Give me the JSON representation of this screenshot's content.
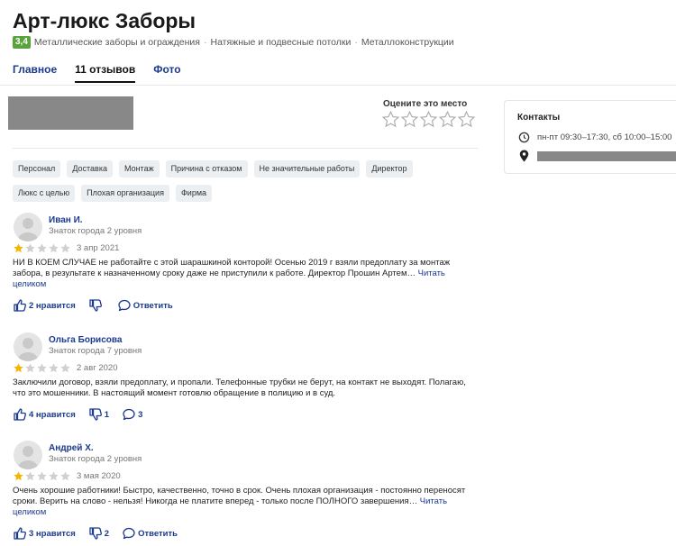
{
  "header": {
    "title": "Арт-люкс Заборы",
    "rating": "3,4",
    "categories": [
      "Металлические заборы и ограждения",
      "Натяжные и подвесные потолки",
      "Металлоконструкции"
    ],
    "category_separator": "·"
  },
  "tabs": [
    {
      "label": "Главное",
      "active": false
    },
    {
      "label": "11 отзывов",
      "active": true
    },
    {
      "label": "Фото",
      "active": false
    }
  ],
  "rate": {
    "label": "Оцените это место",
    "stars": 5
  },
  "contacts": {
    "title": "Контакты",
    "hours": "пн-пт 09:30–17:30, сб 10:00–15:00"
  },
  "tags": [
    "Персонал",
    "Доставка",
    "Монтаж",
    "Причина с отказом",
    "Не значительные работы",
    "Директор",
    "Люкс с целью",
    "Плохая организация",
    "Фирма"
  ],
  "reviews": [
    {
      "author": "Иван И.",
      "level": "Знаток города 2 уровня",
      "rating": 1,
      "date": "3 апр 2021",
      "text": "НИ В КОЕМ СЛУЧАЕ не работайте с этой шарашкиной конторой! Осенью 2019 г взяли предоплату за монтаж забора, в результате к назначенному сроку даже не приступили к работе. Директор Прошин Артем…",
      "read_more": "Читать целиком",
      "likes": "2 нравится",
      "dislikes": "",
      "reply": "Ответить"
    },
    {
      "author": "Ольга Борисова",
      "level": "Знаток города 7 уровня",
      "rating": 1,
      "date": "2 авг 2020",
      "text": "Заключили договор, взяли предоплату, и пропали. Телефонные трубки не берут, на контакт не выходят. Полагаю, что это мошенники. В настоящий момент готовлю обращение в полицию и в суд.",
      "read_more": "",
      "likes": "4 нравится",
      "dislikes": "1",
      "reply": "3"
    },
    {
      "author": "Андрей Х.",
      "level": "Знаток города 2 уровня",
      "rating": 1,
      "date": "3 мая 2020",
      "text": "Очень хорошие работники! Быстро, качественно, точно в срок. Очень плохая организация - постоянно переносят сроки. Верить на слово - нельзя! Никогда не платите вперед - только после ПОЛНОГО завершения…",
      "read_more": "Читать целиком",
      "likes": "3 нравится",
      "dislikes": "2",
      "reply": "Ответить"
    }
  ],
  "colors": {
    "accent": "#1a3a8f",
    "star_on": "#f5b400",
    "star_off": "#c4c4c4",
    "rating_badge": "#5aa33c"
  }
}
